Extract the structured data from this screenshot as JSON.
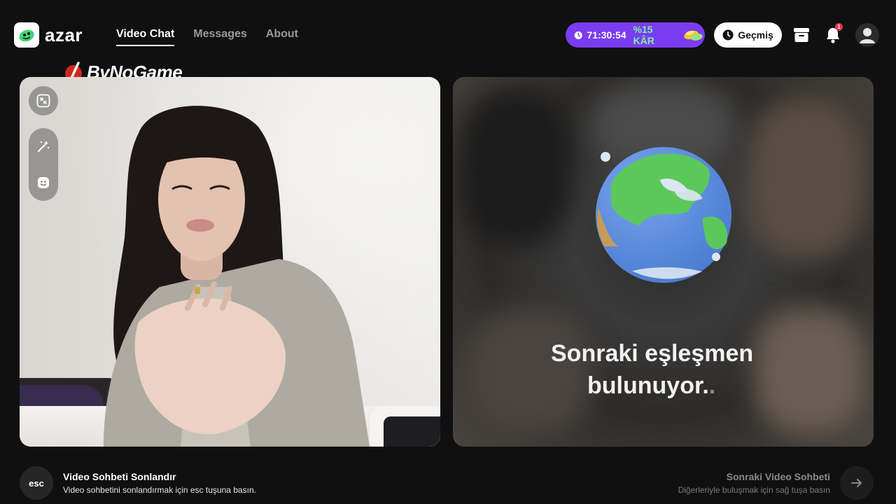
{
  "header": {
    "brand": "azar",
    "nav": [
      {
        "label": "Video Chat",
        "active": true
      },
      {
        "label": "Messages",
        "active": false
      },
      {
        "label": "About",
        "active": false
      }
    ],
    "promo": {
      "timer": "71:30:54",
      "gain": "%15 KÂR"
    },
    "history_label": "Geçmiş",
    "notification_count": "1",
    "icons": {
      "timer": "clock-icon",
      "coins": "coins-icon",
      "history": "clock-icon",
      "store": "store-icon",
      "bell": "bell-icon",
      "avatar": "user-avatar-icon"
    }
  },
  "watermark": "ByNoGame",
  "left_pane": {
    "tools": [
      "minimize-icon",
      "magic-wand-icon",
      "face-sticker-icon"
    ]
  },
  "right_pane": {
    "status_line1": "Sonraki eşleşmen",
    "status_line2": "bulunuyor.",
    "status_dot": "."
  },
  "footer": {
    "end": {
      "key": "esc",
      "title": "Video Sohbeti Sonlandır",
      "subtitle": "Video sohbetini sonlandırmak için esc tuşuna basın."
    },
    "next": {
      "title": "Sonraki Video Sohbeti",
      "subtitle": "Diğerleriyle buluşmak için sağ tuşa basın"
    }
  },
  "colors": {
    "background": "#101010",
    "promo": "#7a3cf0",
    "promo_gain": "#7ff0a8",
    "badge": "#e2354a"
  }
}
